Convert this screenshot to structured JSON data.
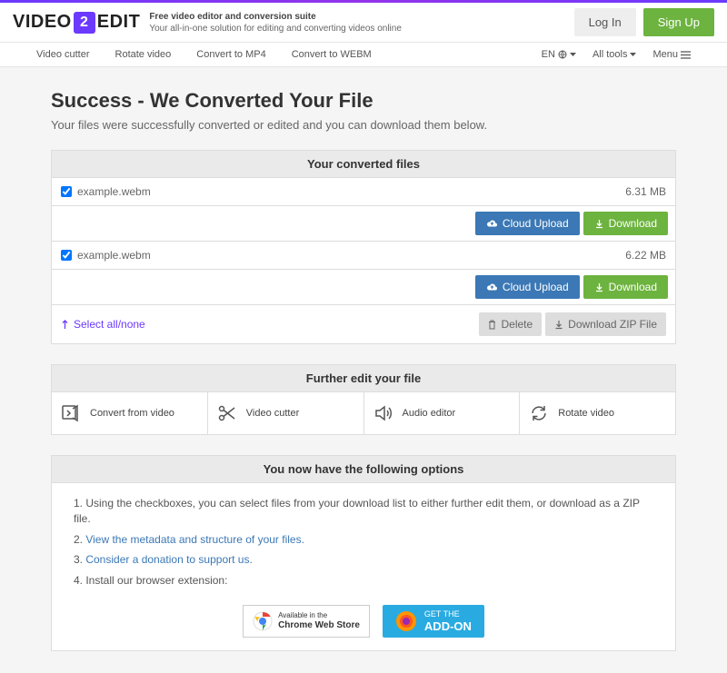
{
  "header": {
    "logo_pre": "VIDEO",
    "logo_num": "2",
    "logo_post": "EDIT",
    "tagline1": "Free video editor and conversion suite",
    "tagline2": "Your all-in-one solution for editing and converting videos online",
    "login": "Log In",
    "signup": "Sign Up"
  },
  "nav": {
    "items": [
      "Video cutter",
      "Rotate video",
      "Convert to MP4",
      "Convert to WEBM"
    ],
    "lang": "EN",
    "all_tools": "All tools",
    "menu": "Menu"
  },
  "page": {
    "title": "Success - We Converted Your File",
    "subtitle": "Your files were successfully converted or edited and you can download them below."
  },
  "files": {
    "heading": "Your converted files",
    "rows": [
      {
        "name": "example.webm",
        "size": "6.31 MB"
      },
      {
        "name": "example.webm",
        "size": "6.22 MB"
      }
    ],
    "cloud": "Cloud Upload",
    "download": "Download",
    "select_all": "Select all/none",
    "delete": "Delete",
    "zip": "Download ZIP File"
  },
  "further": {
    "heading": "Further edit your file",
    "items": [
      "Convert from video",
      "Video cutter",
      "Audio editor",
      "Rotate video"
    ]
  },
  "options": {
    "heading": "You now have the following options",
    "o1": "Using the checkboxes, you can select files from your download list to either further edit them, or download as a ZIP file.",
    "o2": "View the metadata and structure of your files.",
    "o3": "Consider a donation to support us.",
    "o4": "Install our browser extension:",
    "chrome1": "Available in the",
    "chrome2": "Chrome Web Store",
    "ff1": "GET THE",
    "ff2": "ADD-ON"
  }
}
